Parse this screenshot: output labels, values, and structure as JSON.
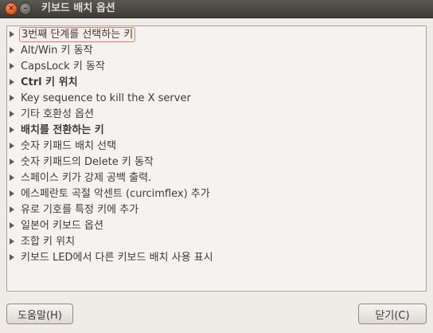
{
  "window": {
    "title": "키보드 배치 옵션",
    "close_glyph": "×",
    "minimize_glyph": "–"
  },
  "tree": {
    "items": [
      {
        "label": "3번째 단계를 선택하는 키",
        "bold": false,
        "focused": true
      },
      {
        "label": "Alt/Win 키 동작",
        "bold": false
      },
      {
        "label": "CapsLock 키 동작",
        "bold": false
      },
      {
        "label": "Ctrl 키 위치",
        "bold": true
      },
      {
        "label": "Key sequence to kill the X server",
        "bold": false
      },
      {
        "label": "기타 호환성 옵션",
        "bold": false
      },
      {
        "label": "배치를 전환하는 키",
        "bold": true
      },
      {
        "label": "숫자 키패드 배치 선택",
        "bold": false
      },
      {
        "label": "숫자 키패드의 Delete 키 동작",
        "bold": false
      },
      {
        "label": "스페이스 키가 강제 공백 출력.",
        "bold": false
      },
      {
        "label": "에스페란토 곡절 악센트 (curcimflex) 추가",
        "bold": false
      },
      {
        "label": "유로 기호를 특정 키에 추가",
        "bold": false
      },
      {
        "label": "일본어 키보드 옵션",
        "bold": false
      },
      {
        "label": "조합 키 위치",
        "bold": false
      },
      {
        "label": "키보드 LED에서 다른 키보드 배치 사용 표시",
        "bold": false
      }
    ]
  },
  "buttons": {
    "help_label": "도움말(H)",
    "close_label": "닫기(C)"
  }
}
